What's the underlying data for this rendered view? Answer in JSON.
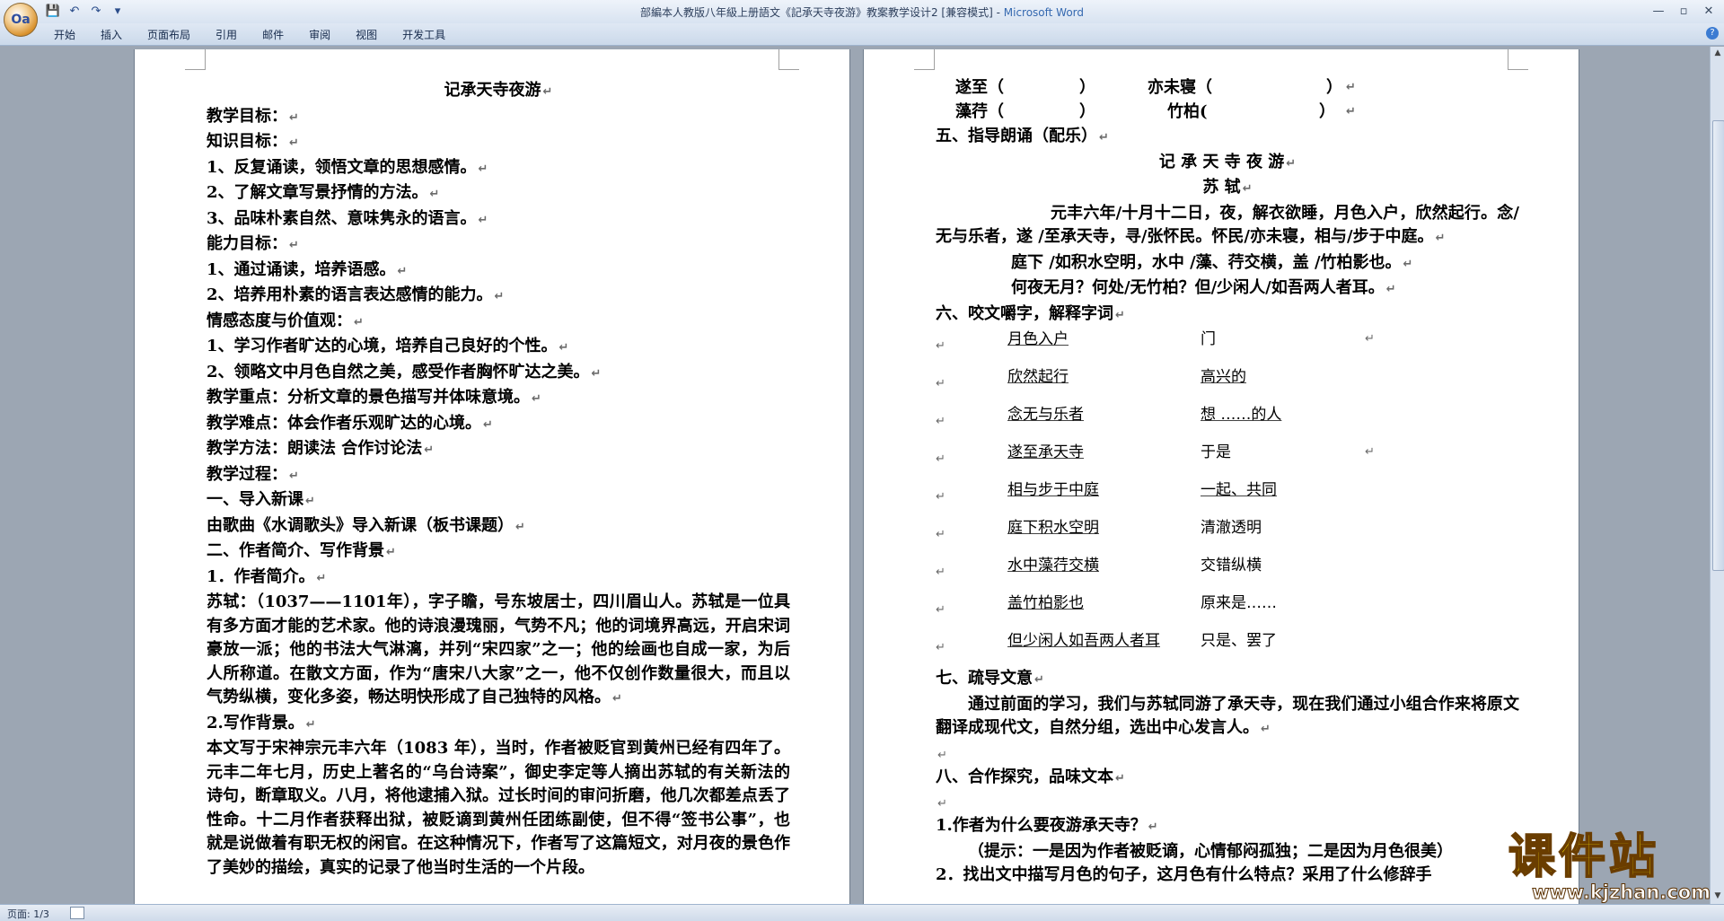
{
  "window": {
    "title": "部編本人教版八年級上册語文《記承天寺夜游》教案教学设计2 [兼容模式]",
    "app_name": "Microsoft Word",
    "office_button_label": "Oa",
    "qat": [
      "💾",
      "↶",
      "↷",
      "▾"
    ],
    "controls": [
      "—",
      "▫",
      "✕"
    ]
  },
  "ribbon": {
    "tabs": [
      "开始",
      "插入",
      "页面布局",
      "引用",
      "邮件",
      "审阅",
      "视图",
      "开发工具"
    ],
    "help": "?"
  },
  "left_page": {
    "title": "记承天寺夜游",
    "lines": [
      "教学目标：",
      "知识目标：",
      "1、反复诵读，领悟文章的思想感情。",
      "2、了解文章写景抒情的方法。",
      "3、品味朴素自然、意味隽永的语言。",
      "能力目标：",
      "1、通过诵读，培养语感。",
      "2、培养用朴素的语言表达感情的能力。",
      "情感态度与价值观：",
      "1、学习作者旷达的心境，培养自己良好的个性。",
      "2、领略文中月色自然之美，感受作者胸怀旷达之美。",
      "教学重点：分析文章的景色描写并体味意境。",
      "教学难点：体会作者乐观旷达的心境。",
      "教学方法：朗读法 合作讨论法",
      "教学过程：",
      "一、导入新课",
      "由歌曲《水调歌头》导入新课（板书课题）",
      "二、作者简介、写作背景",
      "1．作者简介。"
    ],
    "author_para": "苏轼：（1037——1101年），字子瞻，号东坡居士，四川眉山人。苏轼是一位具有多方面才能的艺术家。他的诗浪漫瑰丽，气势不凡；他的词境界高远，开启宋词豪放一派；他的书法大气淋漓，并列“宋四家”之一；他的绘画也自成一家，为后人所称道。在散文方面，作为“唐宋八大家”之一，他不仅创作数量很大，而且以气势纵横，变化多姿，畅达明快形成了自己独特的风格。",
    "bg_heading": "2.写作背景。",
    "bg_para": "本文写于宋神宗元丰六年（1083 年），当时，作者被贬官到黄州已经有四年了。元丰二年七月，历史上著名的“乌台诗案”，御史李定等人摘出苏轼的有关新法的诗句，断章取义。八月，将他逮捕入狱。过长时间的审问折磨，他几次都差点丢了性命。十二月作者获释出狱，被贬谪到黄州任团练副使，但不得“签书公事”，也就是说做着有职无权的闲官。在这种情况下，作者写了这篇短文，对月夜的景色作了美妙的描绘，真实的记录了他当时生活的一个片段。"
  },
  "right_page": {
    "fill_row1": [
      "遂至（",
      "）",
      "亦未寝（",
      "）"
    ],
    "fill_row2": [
      "藻荇（",
      "）",
      "竹柏(",
      "）"
    ],
    "sec5": "五、指导朗诵（配乐）",
    "poem_title": "记 承 天 寺 夜 游",
    "poem_author": "苏  轼",
    "poem_p1": "元丰六年/十月十二日，夜，解衣欲睡，月色入户，欣然起行。念/无与乐者，遂 /至承天寺，寻/张怀民。怀民/亦未寝，相与/步于中庭。",
    "poem_l2": "庭下 /如积水空明，水中 /藻、荇交横，盖 /竹柏影也。",
    "poem_l3": "何夜无月？何处/无竹柏？但/少闲人/如吾两人者耳。",
    "sec6": "六、咬文嚼字，解释字词",
    "words": [
      {
        "w": "月色入户",
        "m": "门"
      },
      {
        "w": "欣然起行",
        "m": "高兴的"
      },
      {
        "w": "念无与乐者",
        "m": "想      ……的人"
      },
      {
        "w": "遂至承天寺",
        "m": "于是"
      },
      {
        "w": "相与步于中庭",
        "m": "一起、共同"
      },
      {
        "w": "庭下积水空明",
        "m": "清澈透明"
      },
      {
        "w": "水中藻荇交横",
        "m": "交错纵横"
      },
      {
        "w": "盖竹柏影也",
        "m": "原来是……"
      },
      {
        "w": "但少闲人如吾两人者耳",
        "m": "只是、罢了"
      }
    ],
    "sec7": "七、疏导文意",
    "sec7_para": "通过前面的学习，我们与苏轼同游了承天寺，现在我们通过小组合作来将原文翻译成现代文，自然分组，选出中心发言人。",
    "sec8": "八、合作探究，品味文本",
    "q1": "1.作者为什么要夜游承天寺？",
    "q1_hint": "（提示：一是因为作者被贬谪，心情郁闷孤独；二是因为月色很美）",
    "q2": "2．找出文中描写月色的句子，这月色有什么特点？采用了什么修辞手"
  },
  "status_bar": {
    "page": "页面: 1/3"
  },
  "watermark": {
    "text": "课件站",
    "url": "www.kjzhan.com"
  }
}
